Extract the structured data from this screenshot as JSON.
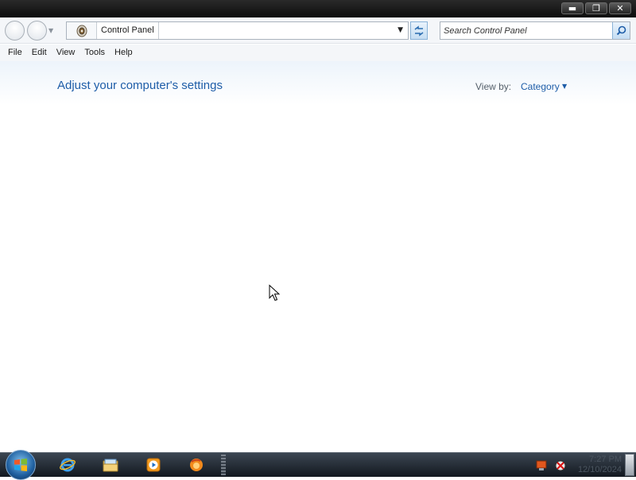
{
  "window": {
    "caption_buttons": {
      "minimize": "▬",
      "restore": "❐",
      "close": "✕"
    }
  },
  "address_bar": {
    "breadcrumb": "Control Panel",
    "icon": "control-panel-icon"
  },
  "search": {
    "placeholder": "Search Control Panel"
  },
  "menu": {
    "items": [
      {
        "label": "File"
      },
      {
        "label": "Edit"
      },
      {
        "label": "View"
      },
      {
        "label": "Tools"
      },
      {
        "label": "Help"
      }
    ]
  },
  "main": {
    "title": "Adjust your computer's settings",
    "view_by_label": "View by:",
    "view_by_value": "Category"
  },
  "taskbar": {
    "pinned": [
      {
        "name": "internet-explorer-icon"
      },
      {
        "name": "windows-explorer-icon"
      },
      {
        "name": "media-player-icon"
      },
      {
        "name": "firefox-icon"
      }
    ],
    "clock": {
      "time": "7:27 PM",
      "date": "12/10/2024"
    }
  },
  "colors": {
    "link_blue": "#1e5da8",
    "taskbar_dark": "#12181f",
    "titlebar_dark": "#0c0c0c"
  }
}
